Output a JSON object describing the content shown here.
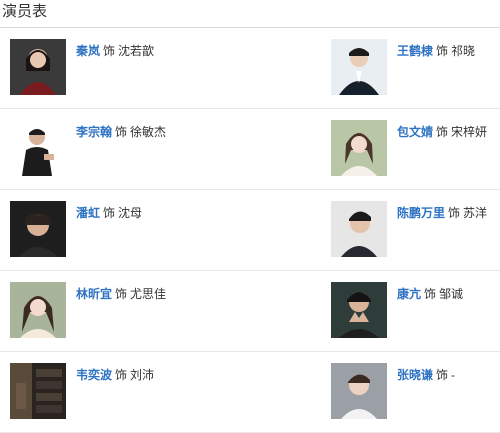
{
  "section_title": "演员表",
  "as_word": "饰",
  "cast": [
    {
      "actor": "秦岚",
      "role": "沈若歆",
      "icon": "actor-photo"
    },
    {
      "actor": "王鹤棣",
      "role": "祁晓",
      "icon": "actor-photo"
    },
    {
      "actor": "李宗翰",
      "role": "徐敏杰",
      "icon": "actor-photo"
    },
    {
      "actor": "包文婧",
      "role": "宋梓妍",
      "icon": "actor-photo"
    },
    {
      "actor": "潘虹",
      "role": "沈母",
      "icon": "actor-photo"
    },
    {
      "actor": "陈鹏万里",
      "role": "苏洋",
      "icon": "actor-photo"
    },
    {
      "actor": "林昕宜",
      "role": "尤思佳",
      "icon": "actor-photo"
    },
    {
      "actor": "康亢",
      "role": "邹诚",
      "icon": "actor-photo"
    },
    {
      "actor": "韦奕波",
      "role": "刘沛",
      "icon": "actor-photo"
    },
    {
      "actor": "张晓谦",
      "role": "-",
      "icon": "actor-photo"
    }
  ],
  "colors": {
    "link": "#2f73c4",
    "text": "#333333",
    "divider": "#e8e8e8"
  }
}
